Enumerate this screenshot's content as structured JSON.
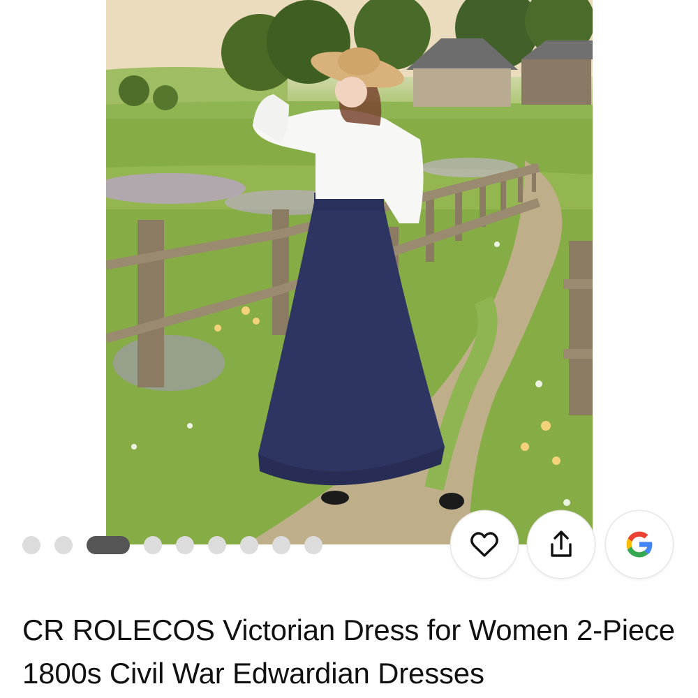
{
  "product": {
    "image_alt": "Woman in a white ruffled blouse, straw hat and long navy skirt standing on a country path beside a wooden fence",
    "title": "CR ROLECOS Victorian Dress for Women 2-Piece 1800s Civil War Edwardian Dresses"
  },
  "carousel": {
    "total": 9,
    "active_index": 2
  },
  "actions": {
    "favorite_icon": "heart-icon",
    "share_icon": "share-icon",
    "google_icon": "google-logo-icon"
  },
  "colors": {
    "active_dot": "#555555",
    "inactive_dot": "#dcdcdc",
    "google_blue": "#4285F4",
    "google_red": "#EA4335",
    "google_yellow": "#FBBC05",
    "google_green": "#34A853"
  }
}
